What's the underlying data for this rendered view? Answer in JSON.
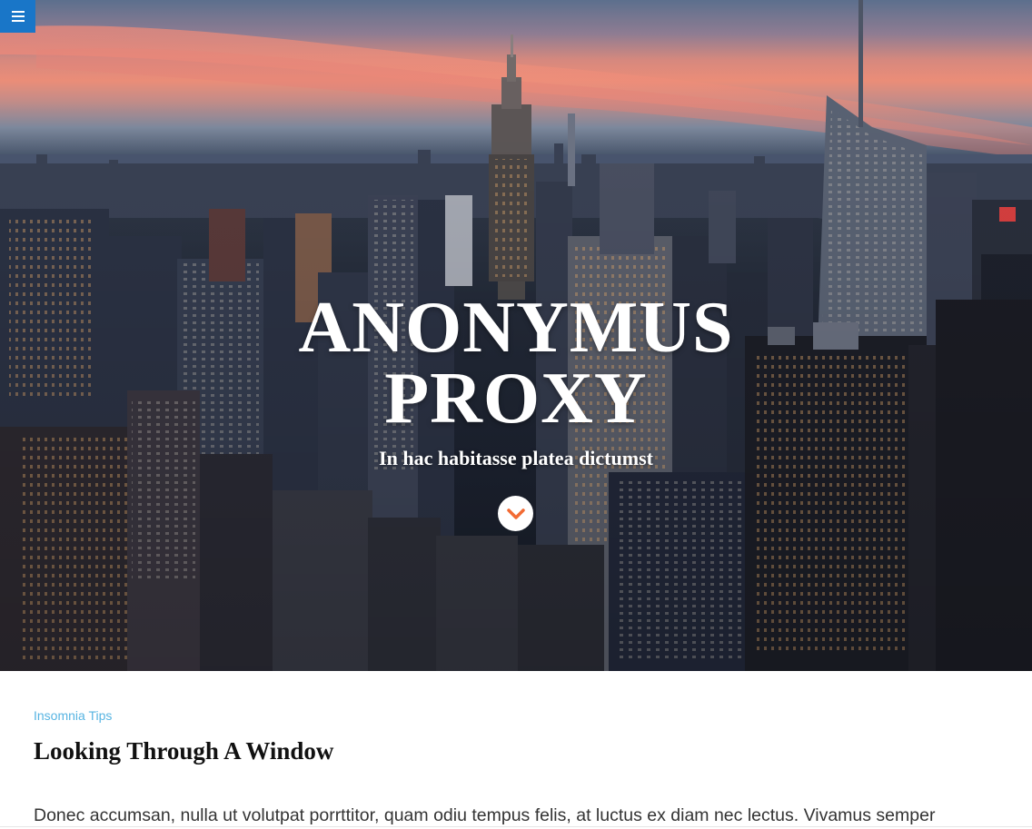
{
  "menu": {
    "icon": "hamburger-menu-icon"
  },
  "hero": {
    "title_line1": "ANONYMUS",
    "title_line2": "PROXY",
    "subtitle": "In hac habitasse platea dictumst",
    "scroll_icon": "chevron-down-icon",
    "accent_color": "#f26a33"
  },
  "article": {
    "category": "Insomnia Tips",
    "title": "Looking Through A Window",
    "excerpt": "Donec accumsan, nulla ut volutpat porrttitor, quam odiu tempus felis, at luctus ex diam nec lectus. Vivamus semper"
  },
  "colors": {
    "menu_button": "#1976c8",
    "category_link": "#57b4e2"
  }
}
